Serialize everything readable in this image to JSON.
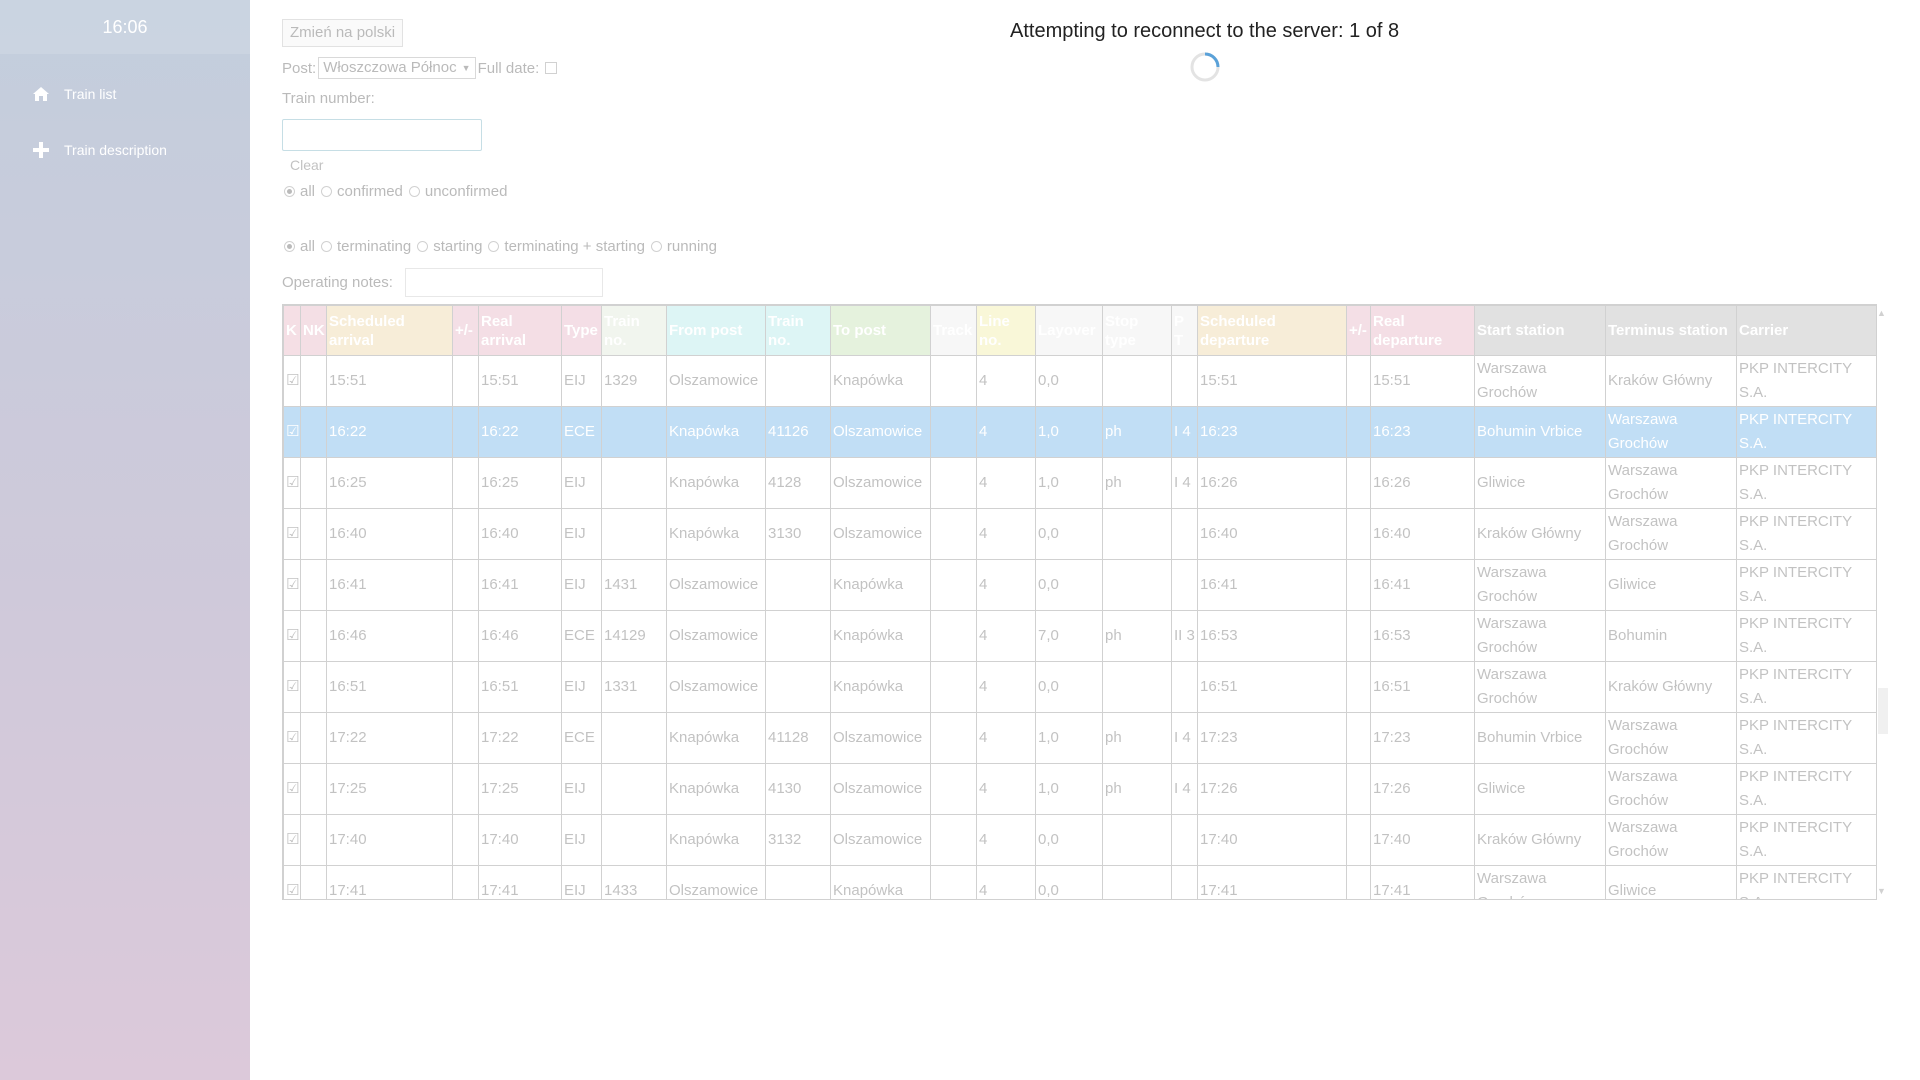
{
  "sidebar": {
    "clock": "16:06",
    "items": [
      {
        "label": "Train list",
        "icon": "home-icon"
      },
      {
        "label": "Train description",
        "icon": "plus-icon"
      }
    ]
  },
  "overlay": {
    "message": "Attempting to reconnect to the server: 1 of 8"
  },
  "controls": {
    "lang_button": "Zmień na polski",
    "post_label": "Post:",
    "post_value": "Włoszczowa Północ",
    "full_date_label": "Full date:",
    "train_number_label": "Train number:",
    "train_number_value": "",
    "clear_label": "Clear",
    "confirm_filter": [
      "all",
      "confirmed",
      "unconfirmed"
    ],
    "type_filter": [
      "all",
      "terminating",
      "starting",
      "terminating + starting",
      "running"
    ],
    "operating_notes_label": "Operating notes:"
  },
  "table": {
    "headers": [
      {
        "label": "K",
        "color": "#e8b8c4"
      },
      {
        "label": "NK",
        "color": "#e6b8c6"
      },
      {
        "label": "Scheduled arrival",
        "color": "#eed6a8"
      },
      {
        "label": "+/-",
        "color": "#e6b8c8"
      },
      {
        "label": "Real arrival",
        "color": "#e6b6c6"
      },
      {
        "label": "Type",
        "color": "#e6b6c8"
      },
      {
        "label": "Train no.",
        "color": "#dfe8d8"
      },
      {
        "label": "From post",
        "color": "#b3e9e9"
      },
      {
        "label": "Train no.",
        "color": "#b3e9e9"
      },
      {
        "label": "To post",
        "color": "#c6e3b4"
      },
      {
        "label": "Track",
        "color": "#eeeeee"
      },
      {
        "label": "Line no.",
        "color": "#f1eda8"
      },
      {
        "label": "Layover",
        "color": "#eeeeee"
      },
      {
        "label": "Stop type",
        "color": "#eeeeee"
      },
      {
        "label": "P T",
        "color": "#eeeeee"
      },
      {
        "label": "Scheduled departure",
        "color": "#eed6a8"
      },
      {
        "label": "+/-",
        "color": "#e6b8c8"
      },
      {
        "label": "Real departure",
        "color": "#e6b6c6"
      },
      {
        "label": "Start station",
        "color": "#bbbbbb"
      },
      {
        "label": "Terminus station",
        "color": "#bbbbbb"
      },
      {
        "label": "Carrier",
        "color": "#bbbbbb"
      }
    ],
    "rows": [
      [
        "☑",
        "",
        "15:51",
        "",
        "15:51",
        "EIJ",
        "1329",
        "Olszamowice",
        "",
        "Knapówka",
        "",
        "4",
        "0,0",
        "",
        "",
        "15:51",
        "",
        "15:51",
        "Warszawa Grochów",
        "Kraków Główny",
        "PKP INTERCITY S.A."
      ],
      [
        "☑",
        "",
        "16:22",
        "",
        "16:22",
        "ECE",
        "",
        "Knapówka",
        "41126",
        "Olszamowice",
        "",
        "4",
        "1,0",
        "ph",
        "I 4",
        "16:23",
        "",
        "16:23",
        "Bohumin Vrbice",
        "Warszawa Grochów",
        "PKP INTERCITY S.A."
      ],
      [
        "☑",
        "",
        "16:25",
        "",
        "16:25",
        "EIJ",
        "",
        "Knapówka",
        "4128",
        "Olszamowice",
        "",
        "4",
        "1,0",
        "ph",
        "I 4",
        "16:26",
        "",
        "16:26",
        "Gliwice",
        "Warszawa Grochów",
        "PKP INTERCITY S.A."
      ],
      [
        "☑",
        "",
        "16:40",
        "",
        "16:40",
        "EIJ",
        "",
        "Knapówka",
        "3130",
        "Olszamowice",
        "",
        "4",
        "0,0",
        "",
        "",
        "16:40",
        "",
        "16:40",
        "Kraków Główny",
        "Warszawa Grochów",
        "PKP INTERCITY S.A."
      ],
      [
        "☑",
        "",
        "16:41",
        "",
        "16:41",
        "EIJ",
        "1431",
        "Olszamowice",
        "",
        "Knapówka",
        "",
        "4",
        "0,0",
        "",
        "",
        "16:41",
        "",
        "16:41",
        "Warszawa Grochów",
        "Gliwice",
        "PKP INTERCITY S.A."
      ],
      [
        "☑",
        "",
        "16:46",
        "",
        "16:46",
        "ECE",
        "14129",
        "Olszamowice",
        "",
        "Knapówka",
        "",
        "4",
        "7,0",
        "ph",
        "II 3",
        "16:53",
        "",
        "16:53",
        "Warszawa Grochów",
        "Bohumin",
        "PKP INTERCITY S.A."
      ],
      [
        "☑",
        "",
        "16:51",
        "",
        "16:51",
        "EIJ",
        "1331",
        "Olszamowice",
        "",
        "Knapówka",
        "",
        "4",
        "0,0",
        "",
        "",
        "16:51",
        "",
        "16:51",
        "Warszawa Grochów",
        "Kraków Główny",
        "PKP INTERCITY S.A."
      ],
      [
        "☑",
        "",
        "17:22",
        "",
        "17:22",
        "ECE",
        "",
        "Knapówka",
        "41128",
        "Olszamowice",
        "",
        "4",
        "1,0",
        "ph",
        "I 4",
        "17:23",
        "",
        "17:23",
        "Bohumin Vrbice",
        "Warszawa Grochów",
        "PKP INTERCITY S.A."
      ],
      [
        "☑",
        "",
        "17:25",
        "",
        "17:25",
        "EIJ",
        "",
        "Knapówka",
        "4130",
        "Olszamowice",
        "",
        "4",
        "1,0",
        "ph",
        "I 4",
        "17:26",
        "",
        "17:26",
        "Gliwice",
        "Warszawa Grochów",
        "PKP INTERCITY S.A."
      ],
      [
        "☑",
        "",
        "17:40",
        "",
        "17:40",
        "EIJ",
        "",
        "Knapówka",
        "3132",
        "Olszamowice",
        "",
        "4",
        "0,0",
        "",
        "",
        "17:40",
        "",
        "17:40",
        "Kraków Główny",
        "Warszawa Grochów",
        "PKP INTERCITY S.A."
      ],
      [
        "☑",
        "",
        "17:41",
        "",
        "17:41",
        "EIJ",
        "1433",
        "Olszamowice",
        "",
        "Knapówka",
        "",
        "4",
        "0,0",
        "",
        "",
        "17:41",
        "",
        "17:41",
        "Warszawa Grochów",
        "Gliwice",
        "PKP INTERCITY S.A."
      ]
    ],
    "selected_row": 1
  }
}
